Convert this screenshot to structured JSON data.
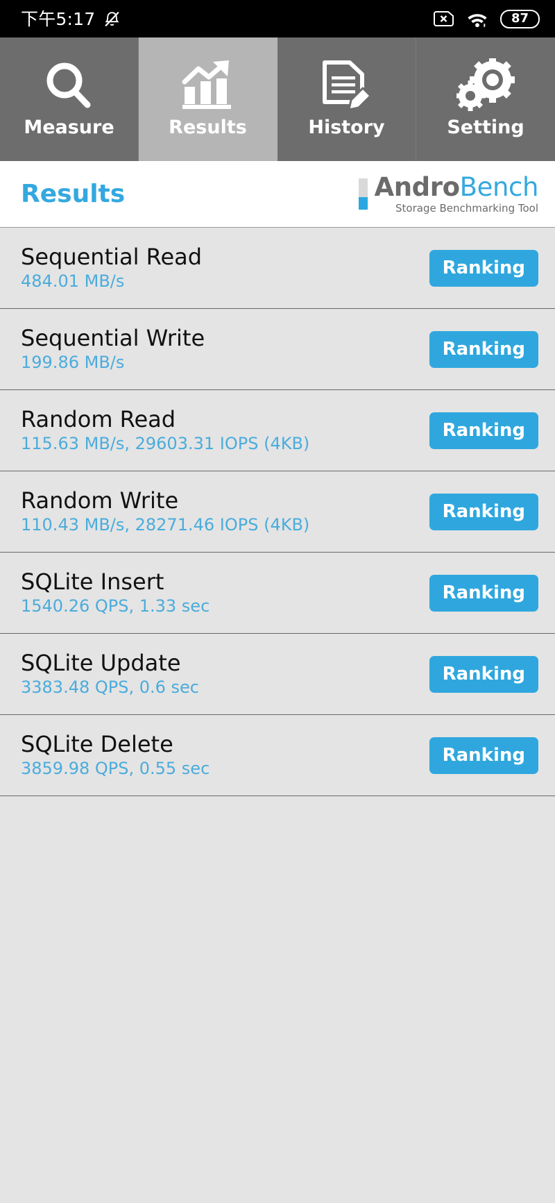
{
  "statusbar": {
    "clock": "下午5:17",
    "mute_icon": "bell-muted-icon",
    "sim_icon": "sim-no-signal-icon",
    "wifi_icon": "wifi-icon",
    "battery_level": "87"
  },
  "tabs": [
    {
      "label": "Measure",
      "icon": "magnifier-icon",
      "active": false
    },
    {
      "label": "Results",
      "icon": "bar-chart-arrow-icon",
      "active": true
    },
    {
      "label": "History",
      "icon": "document-pencil-icon",
      "active": false
    },
    {
      "label": "Setting",
      "icon": "gears-icon",
      "active": false
    }
  ],
  "header": {
    "title": "Results",
    "brand_first": "Andro",
    "brand_second": "Bench",
    "brand_tagline": "Storage Benchmarking Tool"
  },
  "colors": {
    "accent": "#34a8e0",
    "button": "#2fa7de",
    "value_text": "#4aacdc",
    "tab_inactive": "#6d6d6d",
    "tab_active": "#b5b5b5",
    "list_bg": "#e4e4e4"
  },
  "results": {
    "ranking_label": "Ranking",
    "rows": [
      {
        "title": "Sequential Read",
        "value": "484.01 MB/s"
      },
      {
        "title": "Sequential Write",
        "value": "199.86 MB/s"
      },
      {
        "title": "Random Read",
        "value": "115.63 MB/s, 29603.31 IOPS (4KB)"
      },
      {
        "title": "Random Write",
        "value": "110.43 MB/s, 28271.46 IOPS (4KB)"
      },
      {
        "title": "SQLite Insert",
        "value": "1540.26 QPS, 1.33 sec"
      },
      {
        "title": "SQLite Update",
        "value": "3383.48 QPS, 0.6 sec"
      },
      {
        "title": "SQLite Delete",
        "value": "3859.98 QPS, 0.55 sec"
      }
    ]
  }
}
